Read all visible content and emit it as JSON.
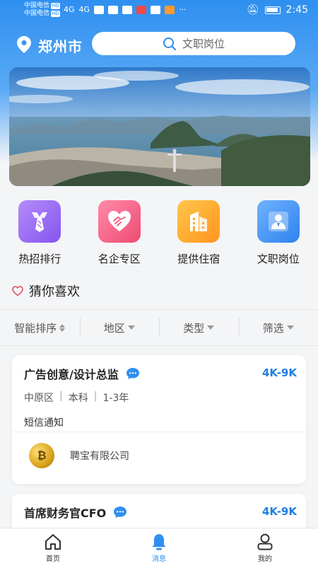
{
  "status_bar": {
    "carrier1": "中国电信",
    "carrier2": "中国电信",
    "hd": "HD",
    "signal": "4G",
    "time": "2:45"
  },
  "header": {
    "city": "郑州市",
    "search_placeholder": "文职岗位"
  },
  "quick_entries": [
    {
      "label": "热招排行",
      "icon": "tie-icon",
      "color": "#9b6af5"
    },
    {
      "label": "名企专区",
      "icon": "handshake-heart-icon",
      "color": "#f0557a"
    },
    {
      "label": "提供住宿",
      "icon": "building-icon",
      "color": "#ffa626"
    },
    {
      "label": "文职岗位",
      "icon": "user-card-icon",
      "color": "#3d8ff5"
    }
  ],
  "guess": {
    "title": "猜你喜欢"
  },
  "filters": [
    {
      "label": "智能排序"
    },
    {
      "label": "地区"
    },
    {
      "label": "类型"
    },
    {
      "label": "筛选"
    }
  ],
  "jobs": [
    {
      "title": "广告创意/设计总监",
      "salary": "4K-9K",
      "district": "中原区",
      "education": "本科",
      "experience": "1-3年",
      "note": "短信通知",
      "company": "聘宝有限公司"
    },
    {
      "title": "首席财务官CFO",
      "salary": "4K-9K"
    }
  ],
  "tabs": [
    {
      "label": "首页"
    },
    {
      "label": "消息"
    },
    {
      "label": "我的"
    }
  ],
  "colors": {
    "accent": "#2f8ff0",
    "salary": "#1e7fe0"
  }
}
